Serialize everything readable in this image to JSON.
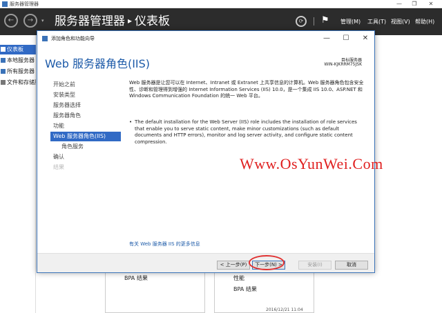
{
  "window": {
    "title": "服务器管理器",
    "controls": {
      "minimize": "—",
      "maximize": "❐",
      "close": "✕"
    }
  },
  "header": {
    "breadcrumb_root": "服务器管理器",
    "breadcrumb_separator": "▸",
    "breadcrumb_current": "仪表板",
    "back_glyph": "←",
    "forward_glyph": "→",
    "dropdown_glyph": "▾",
    "refresh_glyph": "⟳",
    "flag_glyph": "⚑",
    "menus": {
      "manage": "管理(M)",
      "tools": "工具(T)",
      "view": "视图(V)",
      "help": "帮助(H)"
    }
  },
  "sidebar": {
    "items": [
      {
        "label": "仪表板",
        "active": true
      },
      {
        "label": "本地服务器",
        "active": false
      },
      {
        "label": "所有服务器",
        "active": false
      },
      {
        "label": "文件和存储服务",
        "active": false
      }
    ]
  },
  "background": {
    "tile_left_text": "BPA 结果",
    "tile_right_line1": "性能",
    "tile_right_line2": "BPA 结果",
    "timestamp": "2016/12/21 11:04"
  },
  "wizard": {
    "title": "添加角色和功能向导",
    "controls": {
      "minimize": "—",
      "maximize": "☐",
      "close": "✕"
    },
    "heading": "Web 服务器角色(IIS)",
    "target_label": "目标服务器",
    "target_server": "WIN-KJKRRM75JSK",
    "steps": [
      {
        "label": "开始之前",
        "state": "normal",
        "sub": false
      },
      {
        "label": "安装类型",
        "state": "normal",
        "sub": false
      },
      {
        "label": "服务器选择",
        "state": "normal",
        "sub": false
      },
      {
        "label": "服务器角色",
        "state": "normal",
        "sub": false
      },
      {
        "label": "功能",
        "state": "normal",
        "sub": false
      },
      {
        "label": "Web 服务器角色(IIS)",
        "state": "current",
        "sub": false
      },
      {
        "label": "角色服务",
        "state": "normal",
        "sub": true
      },
      {
        "label": "确认",
        "state": "normal",
        "sub": false
      },
      {
        "label": "结果",
        "state": "disabled",
        "sub": false
      }
    ],
    "intro_text": "Web 服务器是让您可以在 Internet、Intranet 或 Extranet 上共享信息的计算机。Web 服务器角色包含安全性、诊断和管理得到增强的 Internet Information Services (IIS) 10.0，是一个集成 IIS 10.0、ASP.NET 和 Windows Communication Foundation 的统一 Web 平台。",
    "bullet_glyph": "•",
    "bullet_text": "The default installation for the Web Server (IIS) role includes the installation of role services that enable you to serve static content, make minor customizations (such as default documents and HTTP errors), monitor and log server activity, and configure static content compression.",
    "more_info_link": "有关 Web 服务器 IIS 的更多信息",
    "buttons": {
      "previous": "< 上一步(P)",
      "next": "下一步(N) >",
      "install": "安装(I)",
      "cancel": "取消"
    }
  },
  "watermark": "Www.OsYunWei.Com",
  "colors": {
    "accent": "#316ac5",
    "header_bg": "#2c2c2c",
    "heading_text": "#1c5aa8",
    "watermark": "#e02020",
    "annotation_ring": "#e03030"
  }
}
